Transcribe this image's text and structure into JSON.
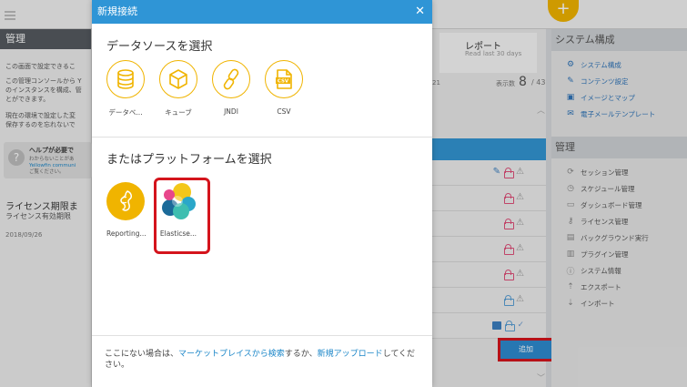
{
  "background": {
    "left_panel": {
      "heading": "管理",
      "text1": "この画面で設定できるこ",
      "text2": "この管理コンソールから Y\nのインスタンスを構成、管\nとができます。",
      "text3": "現在の環境で設定した変\n保存するのを忘れないで",
      "help_title": "ヘルプが必要で",
      "help_body_1": "わからないことがあ",
      "help_body_link": "Yellowfin communi",
      "help_body_2": "ご覧ください。",
      "license_title": "ライセンス期限ま",
      "license_sub": "ライセンス有効期限",
      "license_date": "2018/09/26"
    },
    "report": {
      "title": "レポート",
      "subtitle": "Read last 30 days",
      "count_label": "表示数",
      "count": "8",
      "total": "/ 43",
      "partial_number": "21"
    },
    "add_button": "追加",
    "right_panel": {
      "system_heading": "システム構成",
      "system_items": [
        {
          "icon": "gear-icon",
          "glyph": "⚙",
          "label": "システム構成"
        },
        {
          "icon": "pencil-icon",
          "glyph": "✎",
          "label": "コンテンツ設定"
        },
        {
          "icon": "image-icon",
          "glyph": "▣",
          "label": "イメージとマップ"
        },
        {
          "icon": "mail-icon",
          "glyph": "✉",
          "label": "電子メールテンプレート"
        }
      ],
      "admin_heading": "管理",
      "admin_items": [
        {
          "icon": "session-icon",
          "glyph": "⟳",
          "label": "セッション管理"
        },
        {
          "icon": "clock-icon",
          "glyph": "◷",
          "label": "スケジュール管理"
        },
        {
          "icon": "dashboard-icon",
          "glyph": "▭",
          "label": "ダッシュボード管理"
        },
        {
          "icon": "key-icon",
          "glyph": "⚷",
          "label": "ライセンス管理"
        },
        {
          "icon": "background-icon",
          "glyph": "▤",
          "label": "バックグラウンド実行"
        },
        {
          "icon": "plugin-icon",
          "glyph": "▥",
          "label": "プラグイン管理"
        },
        {
          "icon": "info-icon",
          "glyph": "ⓘ",
          "label": "システム情報"
        },
        {
          "icon": "export-icon",
          "glyph": "⇡",
          "label": "エクスポート"
        },
        {
          "icon": "import-icon",
          "glyph": "⇣",
          "label": "インポート"
        }
      ]
    }
  },
  "modal": {
    "title": "新規接続",
    "close_glyph": "✕",
    "datasource_heading": "データソースを選択",
    "datasources": [
      {
        "icon": "database-icon",
        "label": "データベ..."
      },
      {
        "icon": "cube-icon",
        "label": "キューブ"
      },
      {
        "icon": "jndi-link-icon",
        "label": "JNDI"
      },
      {
        "icon": "csv-file-icon",
        "label": "CSV"
      }
    ],
    "platform_heading": "またはプラットフォームを選択",
    "platforms": [
      {
        "icon": "reporting-icon",
        "label": "Reporting..."
      },
      {
        "icon": "elasticsearch-icon",
        "label": "Elasticse..."
      }
    ],
    "footer_prefix": "ここにない場合は、",
    "footer_link1": "マーケットプレイスから検索",
    "footer_middle": "するか、",
    "footer_link2": "新規アップロード",
    "footer_suffix": "してください。"
  },
  "colors": {
    "accent": "#2f95d6",
    "icon_yellow": "#f0b400",
    "highlight_red": "#d4141c"
  }
}
